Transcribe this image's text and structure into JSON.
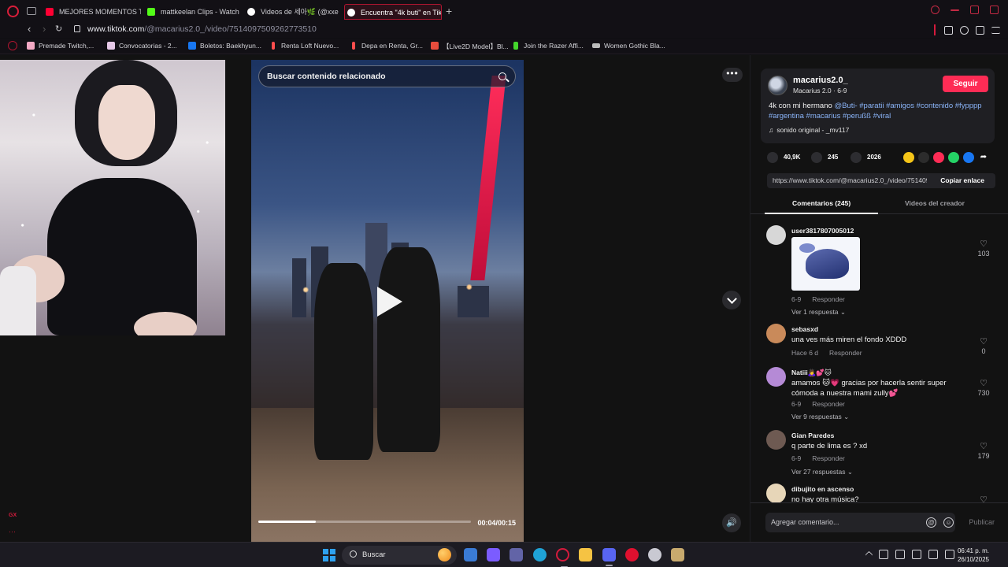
{
  "browser": {
    "tabs": [
      {
        "title": "MEJORES MOMENTOS T",
        "icon": "youtube-icon",
        "color": "#ff0033",
        "active": false
      },
      {
        "title": "mattkeelan Clips - Watch",
        "icon": "kick-icon",
        "color": "#53fc18",
        "active": false
      },
      {
        "title": "Videos de 세아🌿 (@xxe",
        "icon": "tiktok-icon",
        "color": "#ffffff",
        "active": false
      },
      {
        "title": "Encuentra \"4k buti\" en Tik",
        "icon": "tiktok-icon",
        "color": "#ffffff",
        "active": true
      }
    ],
    "new_tab_label": "+",
    "address": {
      "host": "www.tiktok.com",
      "path": "/@macarius2.0_/video/7514097509262773510"
    },
    "bookmarks": [
      {
        "label": "Premade Twitch,...",
        "color": "#f4a9c4"
      },
      {
        "label": "Convocatorias - 2...",
        "color": "#e6c9e8"
      },
      {
        "label": "Boletos: Baekhyun...",
        "color": "#1877f2"
      },
      {
        "label": "Renta Loft Nuevo...",
        "color": "#ff4d4d"
      },
      {
        "label": "Depa en Renta, Gr...",
        "color": "#ff4d4d"
      },
      {
        "label": "【Live2D Model】Bl...",
        "color": "#e74c3c"
      },
      {
        "label": "Join the Razer Affi...",
        "color": "#44d62c"
      },
      {
        "label": "Women Gothic Bla...",
        "color": "#bbbbbb"
      }
    ]
  },
  "player": {
    "search_placeholder": "Buscar contenido relacionado",
    "time": "00:04/00:15",
    "progress": 0.27,
    "more_label": "•••"
  },
  "sidebar": {
    "gx_label": "GX",
    "dots": "···"
  },
  "post": {
    "author_id": "macarius2.0_",
    "author_meta": "Macarius 2.0 · 6-9",
    "follow_label": "Seguir",
    "caption_text": "4k con mi hermano",
    "tags": [
      "@Buti-",
      "#paratii",
      "#amigos",
      "#contenido",
      "#fypppp",
      "#argentina",
      "#macarius",
      "#perußß",
      "#viral"
    ],
    "sound": "sonido original - _mv117",
    "likes": "40,9K",
    "comments_count": "245",
    "saves": "2026",
    "share_colors": [
      "#f5c518",
      "#2c2c2c",
      "#fe2c55",
      "#25d366",
      "#1877f2",
      "#ffffff"
    ],
    "link": "https://www.tiktok.com/@macarius2.0_/video/7514097509262773510",
    "copy_label": "Copiar enlace",
    "tab_comments": "Comentarios (245)",
    "tab_creator": "Videos del creador"
  },
  "comments": [
    {
      "user": "user3817807005012",
      "text": "",
      "sticker": true,
      "date": "6-9",
      "reply": "Responder",
      "likes": "103",
      "more": "Ver 1 respuesta",
      "avatar_color": "#d7d7d7"
    },
    {
      "user": "sebasxd",
      "text": "una ves más miren el fondo XDDD",
      "sticker": false,
      "date": "Hace 6 d",
      "reply": "Responder",
      "likes": "0",
      "more": "",
      "avatar_color": "#c98a5a"
    },
    {
      "user": "Natiii🙇‍♀️💕🐱",
      "text": "amamos 🐱💗 gracias por hacerla sentir super cómoda a nuestra mami zully💕",
      "sticker": false,
      "date": "6-9",
      "reply": "Responder",
      "likes": "730",
      "more": "Ver 9 respuestas",
      "avatar_color": "#b58ad6"
    },
    {
      "user": "Gian Paredes",
      "text": "q parte de lima es ? xd",
      "sticker": false,
      "date": "6-9",
      "reply": "Responder",
      "likes": "179",
      "more": "Ver 27 respuestas",
      "avatar_color": "#6e5a52"
    },
    {
      "user": "dibujito en ascenso",
      "text": "no hay otra música?",
      "sticker": false,
      "date": "",
      "reply": "",
      "likes": "",
      "more": "",
      "avatar_color": "#e7d6b8"
    }
  ],
  "composer": {
    "placeholder": "Agregar comentario...",
    "publish_label": "Publicar"
  },
  "taskbar": {
    "search_label": "Buscar",
    "time": "06:41 p. m.",
    "date": "26/10/2025",
    "apps": [
      {
        "name": "microsoft-store-icon",
        "color": "#3a7bd5"
      },
      {
        "name": "copilot-icon",
        "color": "#7b5cff"
      },
      {
        "name": "teams-icon",
        "color": "#6264a7"
      },
      {
        "name": "edge-icon",
        "color": "#1fa2d6"
      },
      {
        "name": "opera-gx-icon",
        "color": "#d51a3c"
      },
      {
        "name": "file-explorer-icon",
        "color": "#f6c343"
      },
      {
        "name": "discord-icon",
        "color": "#5865f2"
      },
      {
        "name": "opera-icon",
        "color": "#e0102f"
      },
      {
        "name": "steam-icon",
        "color": "#c9c9d2"
      },
      {
        "name": "league-icon",
        "color": "#c8aa6e"
      }
    ]
  }
}
